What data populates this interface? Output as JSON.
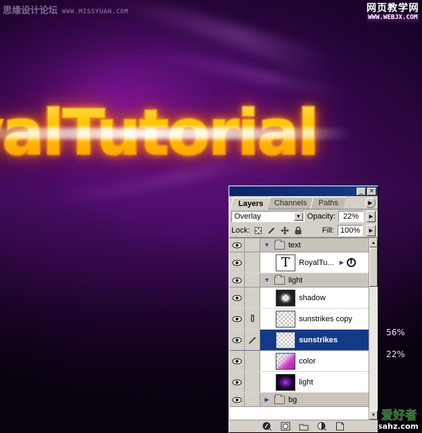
{
  "artwork": {
    "title_text": "yalTutorial",
    "background_colors": [
      "#2a0540",
      "#57107a",
      "#0e0216"
    ],
    "text_fill_color": "#ffd21a",
    "text_stroke_color": "#f08a0c"
  },
  "watermarks": {
    "top_left": {
      "cn": "思缘设计论坛",
      "url": "WWW.MISSYUAN.COM"
    },
    "top_right": {
      "cn": "网页教学网",
      "url": "WWW.WEBJX.COM"
    },
    "bottom_right": {
      "ps": "PS",
      "cn": "爱好者",
      "url": "www.psahz.com"
    }
  },
  "annotations": [
    {
      "name": "sunstrikes-copy-opacity",
      "value": "56%"
    },
    {
      "name": "sunstrikes-opacity",
      "value": "22%"
    }
  ],
  "panel": {
    "titlebar": {
      "minimize_label": "_",
      "close_label": "×"
    },
    "tabs": [
      {
        "label": "Layers",
        "active": true
      },
      {
        "label": "Channels",
        "active": false
      },
      {
        "label": "Paths",
        "active": false
      }
    ],
    "tab_menu_icon": "▶",
    "controls": {
      "blend_mode": "Overlay",
      "blend_dropdown_icon": "▼",
      "opacity_label": "Opacity:",
      "opacity_value": "22%",
      "opacity_spin_icon": "▶",
      "lock_label": "Lock:",
      "lock_icons": [
        "lock-transparency-icon",
        "lock-image-icon",
        "lock-position-icon",
        "lock-all-icon"
      ],
      "fill_label": "Fill:",
      "fill_value": "100%",
      "fill_spin_icon": "▶"
    },
    "layers": [
      {
        "name": "text",
        "type": "group",
        "visible": true,
        "expanded": true,
        "selected": false,
        "indent": 0
      },
      {
        "name": "RoyalTu...",
        "type": "text",
        "visible": true,
        "selected": false,
        "indent": 1,
        "thumb": "T",
        "has_fx": true,
        "fx_icon": "f",
        "fx_expand_icon": "▶"
      },
      {
        "name": "light",
        "type": "group",
        "visible": true,
        "expanded": true,
        "selected": false,
        "indent": 0
      },
      {
        "name": "shadow",
        "type": "raster",
        "visible": true,
        "selected": false,
        "indent": 1,
        "thumb": "shadow-thumb"
      },
      {
        "name": "sunstrikes copy",
        "type": "raster",
        "visible": true,
        "linked": true,
        "selected": false,
        "indent": 1,
        "thumb": "transparent-thumb"
      },
      {
        "name": "sunstrikes",
        "type": "raster",
        "visible": true,
        "selected": true,
        "active_brush": true,
        "indent": 1,
        "thumb": "transparent-thumb"
      },
      {
        "name": "color",
        "type": "raster",
        "visible": true,
        "selected": false,
        "indent": 1,
        "thumb": "color-gradient-thumb"
      },
      {
        "name": "light",
        "type": "raster",
        "visible": true,
        "selected": false,
        "indent": 1,
        "thumb": "light-glow-thumb"
      },
      {
        "name": "bg",
        "type": "group",
        "visible": true,
        "expanded": false,
        "selected": false,
        "indent": 0
      }
    ],
    "scrollbar": {
      "up_icon": "▲",
      "down_icon": "▼"
    },
    "bottom_toolbar": [
      {
        "name": "layer-style-button",
        "icon": "fx-circle"
      },
      {
        "name": "layer-mask-button",
        "icon": "mask-circle"
      },
      {
        "name": "new-group-button",
        "icon": "folder"
      },
      {
        "name": "adjustment-layer-button",
        "icon": "half-circle"
      },
      {
        "name": "new-layer-button",
        "icon": "page"
      }
    ]
  }
}
